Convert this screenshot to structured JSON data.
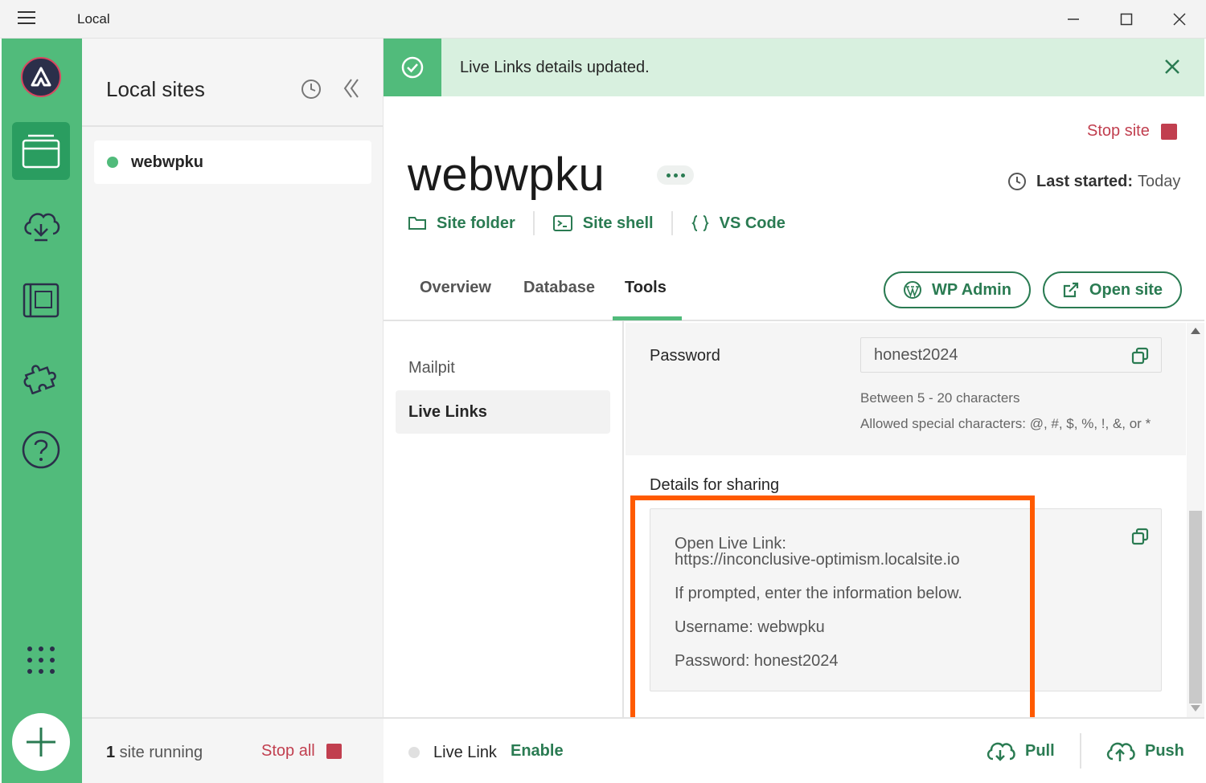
{
  "window": {
    "title": "Local"
  },
  "sites_panel": {
    "title": "Local sites",
    "sites": [
      {
        "name": "webwpku",
        "status": "running"
      }
    ],
    "footer": {
      "running_count": "1",
      "running_text": " site running",
      "stop_all": "Stop all"
    }
  },
  "toast": {
    "message": "Live Links details updated."
  },
  "site": {
    "name": "webwpku",
    "stop_site": "Stop site",
    "last_started_label": "Last started:",
    "last_started_value": "Today",
    "links": {
      "site_folder": "Site folder",
      "site_shell": "Site shell",
      "vs_code": "VS Code"
    },
    "tabs": {
      "overview": "Overview",
      "database": "Database",
      "tools": "Tools"
    },
    "wp_admin": "WP Admin",
    "open_site": "Open site"
  },
  "tools": {
    "nav": {
      "mailpit": "Mailpit",
      "live_links": "Live Links"
    },
    "password": {
      "label": "Password",
      "value": "honest2024",
      "hint1": "Between 5 - 20 characters",
      "hint2": "Allowed special characters: @, #, $, %, !, &, or *"
    },
    "sharing": {
      "label": "Details for sharing",
      "line1": "Open Live Link:",
      "line2": "https://inconclusive-optimism.localsite.io",
      "line3": "If prompted, enter the information below.",
      "line4": "Username: webwpku",
      "line5": "Password: honest2024"
    }
  },
  "footer": {
    "live_link_label": "Live Link",
    "enable": "Enable",
    "pull": "Pull",
    "push": "Push"
  },
  "colors": {
    "brand_green": "#51bb7b",
    "dark_green": "#2a7b52",
    "stop_red": "#c13f4f",
    "highlight_orange": "#ff5a00"
  }
}
